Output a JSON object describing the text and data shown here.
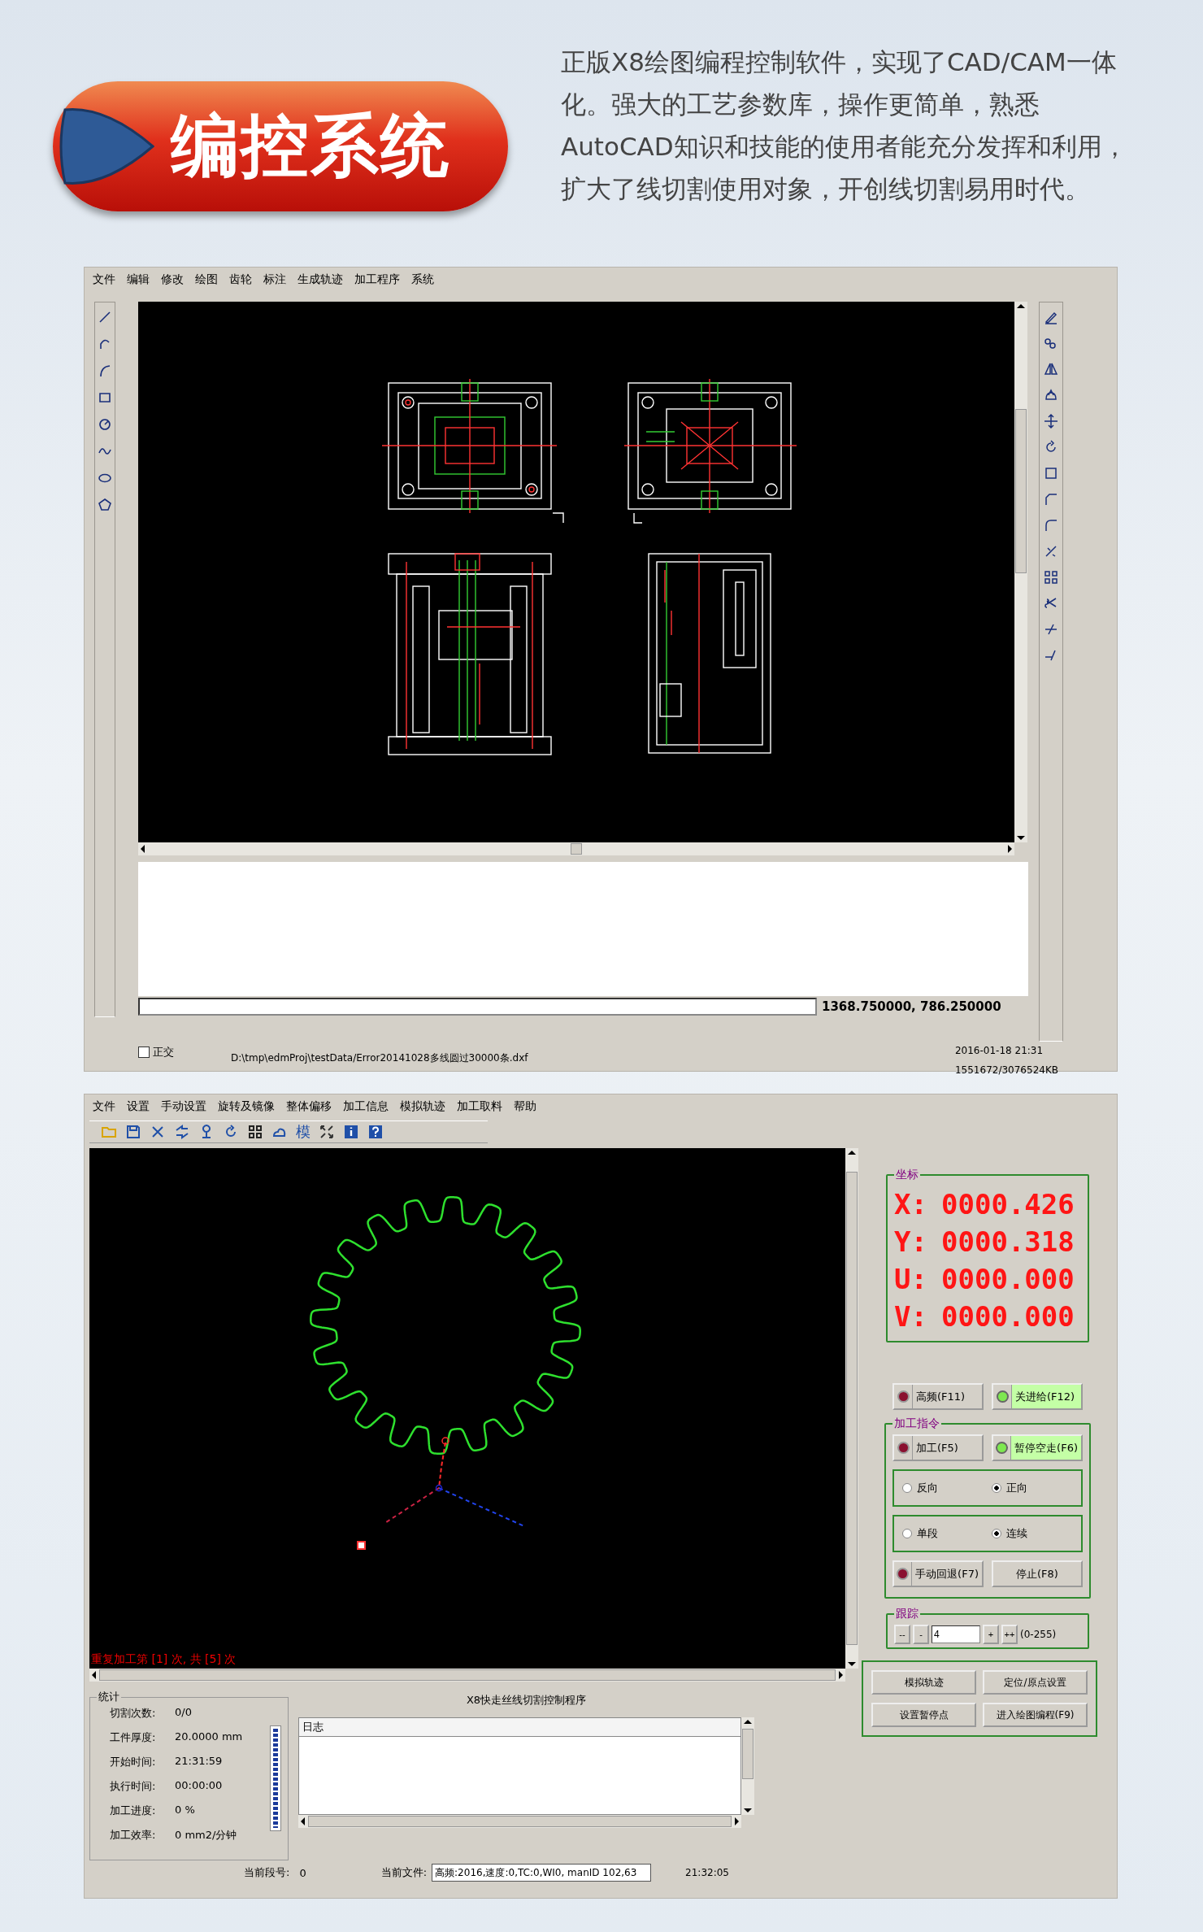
{
  "header": {
    "title": "编控系统",
    "description": "正版X8绘图编程控制软件，实现了CAD/CAM一体化。强大的工艺参数库，操作更简单，熟悉AutoCAD知识和技能的使用者能充分发挥和利用，扩大了线切割使用对象，开创线切割易用时代。"
  },
  "cad_window": {
    "menu": [
      "文件",
      "编辑",
      "修改",
      "绘图",
      "齿轮",
      "标注",
      "生成轨迹",
      "加工程序",
      "系统"
    ],
    "coordinates": "1368.750000, 786.250000",
    "ortho": {
      "label": "正交",
      "checked": false
    },
    "file_path": "D:\\tmp\\edmProj\\testData/Error20141028多线圆过30000条.dxf",
    "datetime": "2016-01-18  21:31",
    "memory": "1551672/3076524KB"
  },
  "control_window": {
    "menu": [
      "文件",
      "设置",
      "手动设置",
      "旋转及镜像",
      "整体偏移",
      "加工信息",
      "模拟轨迹",
      "加工取料",
      "帮助"
    ],
    "toolbar_text": "模",
    "canvas_status": "重复加工第 [1] 次, 共 [5] 次",
    "coordinates": {
      "title": "坐标",
      "axes": [
        {
          "label": "X:",
          "value": "0000.426"
        },
        {
          "label": "Y:",
          "value": "0000.318"
        },
        {
          "label": "U:",
          "value": "0000.000"
        },
        {
          "label": "V:",
          "value": "0000.000"
        }
      ]
    },
    "toggles": [
      {
        "label": "高频(F11)",
        "on": false
      },
      {
        "label": "关进给(F12)",
        "on": true
      }
    ],
    "commands": {
      "title": "加工指令",
      "buttons": [
        {
          "label": "加工(F5)",
          "on": false
        },
        {
          "label": "暂停空走(F6)",
          "on": true
        }
      ],
      "direction": [
        {
          "label": "反向",
          "selected": false
        },
        {
          "label": "正向",
          "selected": true
        }
      ],
      "mode": [
        {
          "label": "单段",
          "selected": false
        },
        {
          "label": "连续",
          "selected": true
        }
      ],
      "manual_back": {
        "label": "手动回退(F7)",
        "on": false
      },
      "stop": "停止(F8)"
    },
    "tracking": {
      "title": "跟踪",
      "minus": [
        "--",
        "-"
      ],
      "value": "4",
      "plus": [
        "+",
        "++"
      ],
      "range": "(0-255)"
    },
    "statistics": {
      "title": "统计",
      "rows": [
        {
          "label": "切割次数:",
          "value": "0/0"
        },
        {
          "label": "工件厚度:",
          "value": "20.0000 mm"
        },
        {
          "label": "开始时间:",
          "value": "21:31:59"
        },
        {
          "label": "执行时间:",
          "value": "00:00:00"
        },
        {
          "label": "加工进度:",
          "value": "0 %"
        },
        {
          "label": "加工效率:",
          "value": "0 mm2/分钟"
        }
      ],
      "level": 1
    },
    "program_title": "X8快走丝线切割控制程序",
    "log": {
      "header": "日志"
    },
    "segment": {
      "label": "当前段号:",
      "value": "0"
    },
    "current_file": {
      "label": "当前文件:",
      "value": "高频:2016,速度:0,TC:0,WI0, manID 102,63"
    },
    "clock": "21:32:05",
    "actions": [
      "模拟轨迹",
      "定位/原点设置",
      "设置暂停点",
      "进入绘图编程(F9)"
    ]
  }
}
